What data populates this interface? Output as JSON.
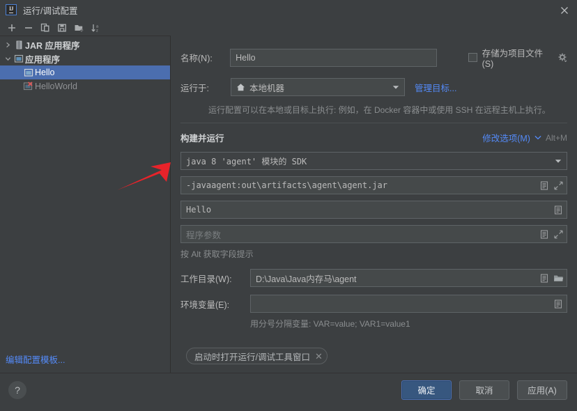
{
  "window": {
    "title": "运行/调试配置",
    "logo_text": "IJ",
    "close_icon": "close-icon"
  },
  "toolbar": {
    "items": [
      {
        "name": "add-configuration-button",
        "icon": "plus-icon"
      },
      {
        "name": "remove-configuration-button",
        "icon": "minus-icon"
      },
      {
        "name": "copy-configuration-button",
        "icon": "copy-icon"
      },
      {
        "name": "save-configuration-button",
        "icon": "save-icon"
      },
      {
        "name": "new-folder-button",
        "icon": "new-folder-icon"
      },
      {
        "name": "sort-configurations-button",
        "icon": "sort-alpha-icon"
      }
    ]
  },
  "sidebar": {
    "tree": [
      {
        "label": "JAR 应用程序",
        "expanded": false,
        "icon": "jar-icon",
        "bold": true,
        "depth": 0,
        "selected": false,
        "error": false
      },
      {
        "label": "应用程序",
        "expanded": true,
        "icon": "application-icon",
        "bold": true,
        "depth": 0,
        "selected": false,
        "error": false
      },
      {
        "label": "Hello",
        "icon": "application-icon",
        "bold": false,
        "depth": 1,
        "selected": true,
        "error": false
      },
      {
        "label": "HelloWorld",
        "icon": "application-icon",
        "bold": false,
        "depth": 1,
        "selected": false,
        "error": true
      }
    ],
    "edit_templates_link": "编辑配置模板..."
  },
  "form": {
    "name_label": "名称(N):",
    "name_value": "Hello",
    "store_as_project_file_label": "存储为项目文件(S)",
    "store_as_project_file_checked": false,
    "gear_icon": "gear-icon",
    "run_on_label": "运行于:",
    "run_on_value": "本地机器",
    "run_on_icon": "home-icon",
    "manage_targets_link": "管理目标...",
    "run_on_hint": "运行配置可以在本地或目标上执行: 例如，在 Docker 容器中或使用 SSH 在远程主机上执行。",
    "section_title": "构建并运行",
    "modify_options_link": "修改选项(M)",
    "modify_options_shortcut": "Alt+M",
    "jre_value": "java 8 'agent' 模块的 SDK",
    "vm_options_value": "-javaagent:out\\artifacts\\agent\\agent.jar",
    "main_class_value": "Hello",
    "program_args_placeholder": "程序参数",
    "program_args_value": "",
    "alt_hint": "按 Alt 获取字段提示",
    "working_dir_label": "工作目录(W):",
    "working_dir_value": "D:\\Java\\Java内存马\\agent",
    "env_vars_label": "环境变量(E):",
    "env_vars_value": "",
    "env_vars_hint": "用分号分隔变量: VAR=value; VAR1=value1",
    "chip_label": "启动时打开运行/调试工具窗口",
    "chip_close_icon": "close-icon"
  },
  "footer": {
    "help_label": "?",
    "ok_label": "确定",
    "cancel_label": "取消",
    "apply_label": "应用(A)"
  },
  "annotation": {
    "arrow_color": "#e8232a",
    "arrow_target": "vm-options-field"
  },
  "colors": {
    "background": "#3c3f41",
    "selection": "#4b6eaf",
    "link": "#548af7",
    "field_bg": "#45494a",
    "primary_button": "#37577f",
    "error": "#e05555"
  }
}
